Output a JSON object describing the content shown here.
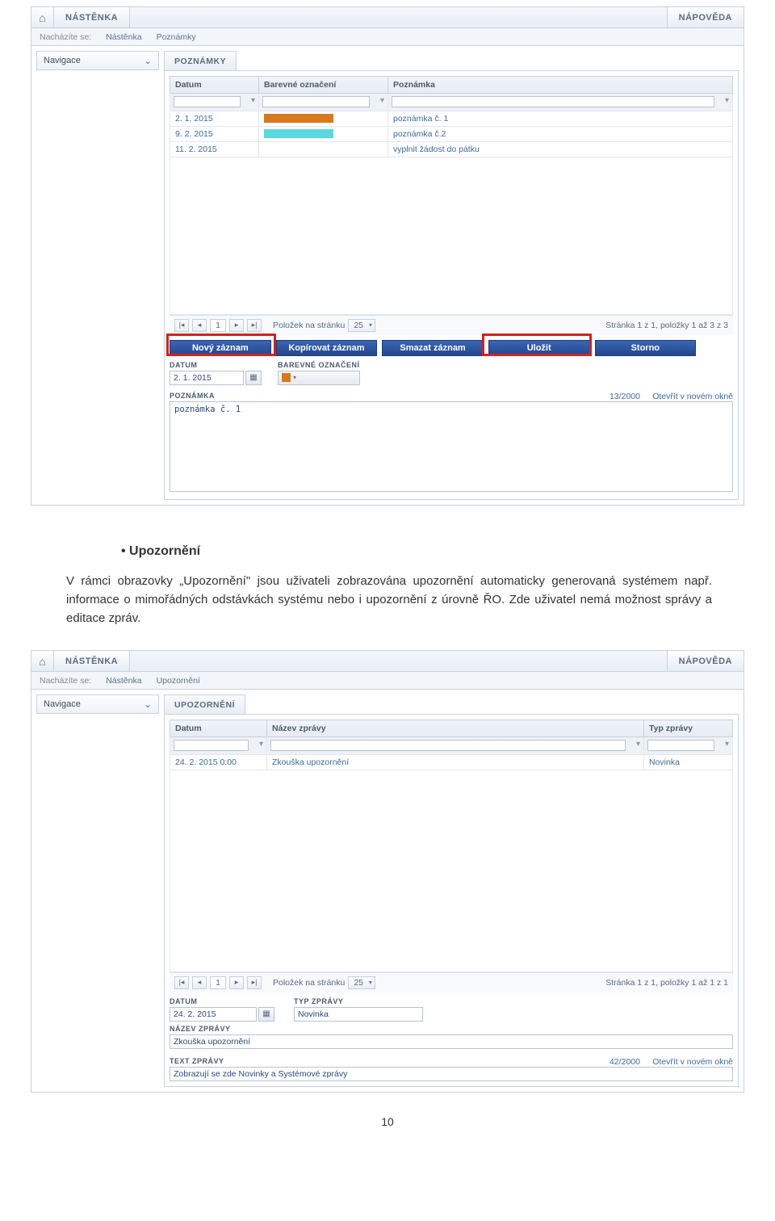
{
  "header": {
    "nastenka": "NÁSTĚNKA",
    "napoveda": "NÁPOVĚDA"
  },
  "crumbs": {
    "label": "Nacházíte se:",
    "item1": "Nástěnka",
    "poznamky": "Poznámky",
    "upozorneni": "Upozornění"
  },
  "nav": {
    "label": "Navigace"
  },
  "poznamky": {
    "panel_title": "POZNÁMKY",
    "cols": {
      "datum": "Datum",
      "barevne": "Barevné označení",
      "poznamka": "Poznámka"
    },
    "rows": [
      {
        "datum": "2. 1. 2015",
        "color": "sw-orange",
        "text": "poznámka č. 1"
      },
      {
        "datum": "9. 2. 2015",
        "color": "sw-cyan",
        "text": "poznámka č.2"
      },
      {
        "datum": "11. 2. 2015",
        "color": "",
        "text": "vyplnit žádost do pátku"
      }
    ],
    "pager": {
      "page": "1",
      "pp_label": "Položek na stránku",
      "pp_value": "25",
      "summary": "Stránka 1 z 1, položky 1 až 3 z 3"
    },
    "actions": {
      "novy": "Nový záznam",
      "kopirovat": "Kopírovat záznam",
      "smazat": "Smazat záznam",
      "ulozit": "Uložit",
      "storno": "Storno"
    },
    "form": {
      "datum_lbl": "DATUM",
      "datum_val": "2. 1. 2015",
      "barevne_lbl": "BAREVNÉ OZNAČENÍ",
      "poznamka_lbl": "POZNÁMKA",
      "poznamka_val": "poznámka č. 1",
      "counter": "13/2000",
      "open_new": "Otevřít v novém okně"
    }
  },
  "doc": {
    "heading": "Upozornění",
    "para": "V rámci obrazovky „Upozornění\" jsou uživateli zobrazována upozornění automaticky generovaná systémem např. informace o mimořádných odstávkách systému nebo i upozornění z úrovně ŘO. Zde uživatel nemá možnost správy a editace zpráv."
  },
  "upozorneni": {
    "panel_title": "UPOZORNĚNÍ",
    "cols": {
      "datum": "Datum",
      "nazev": "Název zprávy",
      "typ": "Typ zprávy"
    },
    "rows": [
      {
        "datum": "24. 2. 2015 0:00",
        "nazev": "Zkouška upozornění",
        "typ": "Novinka"
      }
    ],
    "pager": {
      "page": "1",
      "pp_label": "Položek na stránku",
      "pp_value": "25",
      "summary": "Stránka 1 z 1, položky 1 až 1 z 1"
    },
    "form": {
      "datum_lbl": "DATUM",
      "datum_val": "24. 2. 2015",
      "typ_lbl": "TYP ZPRÁVY",
      "typ_val": "Novinka",
      "nazev_lbl": "NÁZEV ZPRÁVY",
      "nazev_val": "Zkouška upozornění",
      "text_lbl": "TEXT ZPRÁVY",
      "text_val": "Zobrazují se zde Novinky a Systémové zprávy",
      "counter": "42/2000",
      "open_new": "Otevřít v novém okně"
    }
  },
  "pagenum": "10"
}
